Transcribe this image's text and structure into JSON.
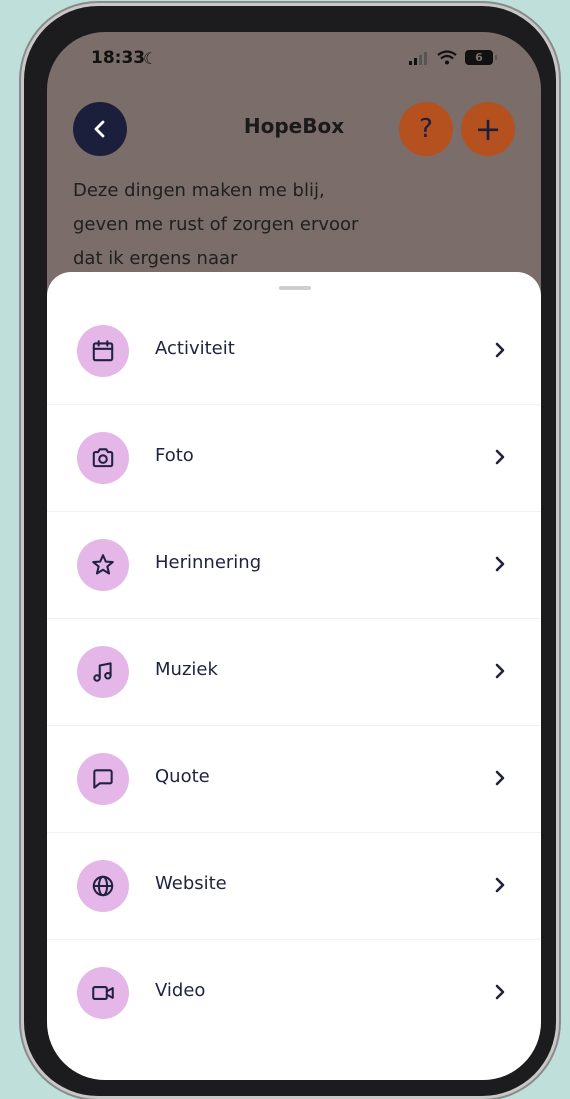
{
  "status_bar": {
    "time": "18:33",
    "battery": "6"
  },
  "header": {
    "title": "HopeBox",
    "help_label": "?",
    "add_label": "+"
  },
  "intro_text": "Deze dingen maken me blij, geven me rust of zorgen ervoor dat ik ergens naar",
  "menu": {
    "items": [
      {
        "label": "Activiteit",
        "icon": "calendar-icon"
      },
      {
        "label": "Foto",
        "icon": "camera-icon"
      },
      {
        "label": "Herinnering",
        "icon": "star-icon"
      },
      {
        "label": "Muziek",
        "icon": "music-note-icon"
      },
      {
        "label": "Quote",
        "icon": "speech-bubble-icon"
      },
      {
        "label": "Website",
        "icon": "globe-icon"
      },
      {
        "label": "Video",
        "icon": "video-camera-icon"
      }
    ]
  },
  "colors": {
    "icon_bg": "#e5b7e9",
    "back_button": "#1b1f3b",
    "action_button": "#b5501f",
    "overlay_bg": "#7b6d69",
    "page_bg": "#bfe0da"
  }
}
